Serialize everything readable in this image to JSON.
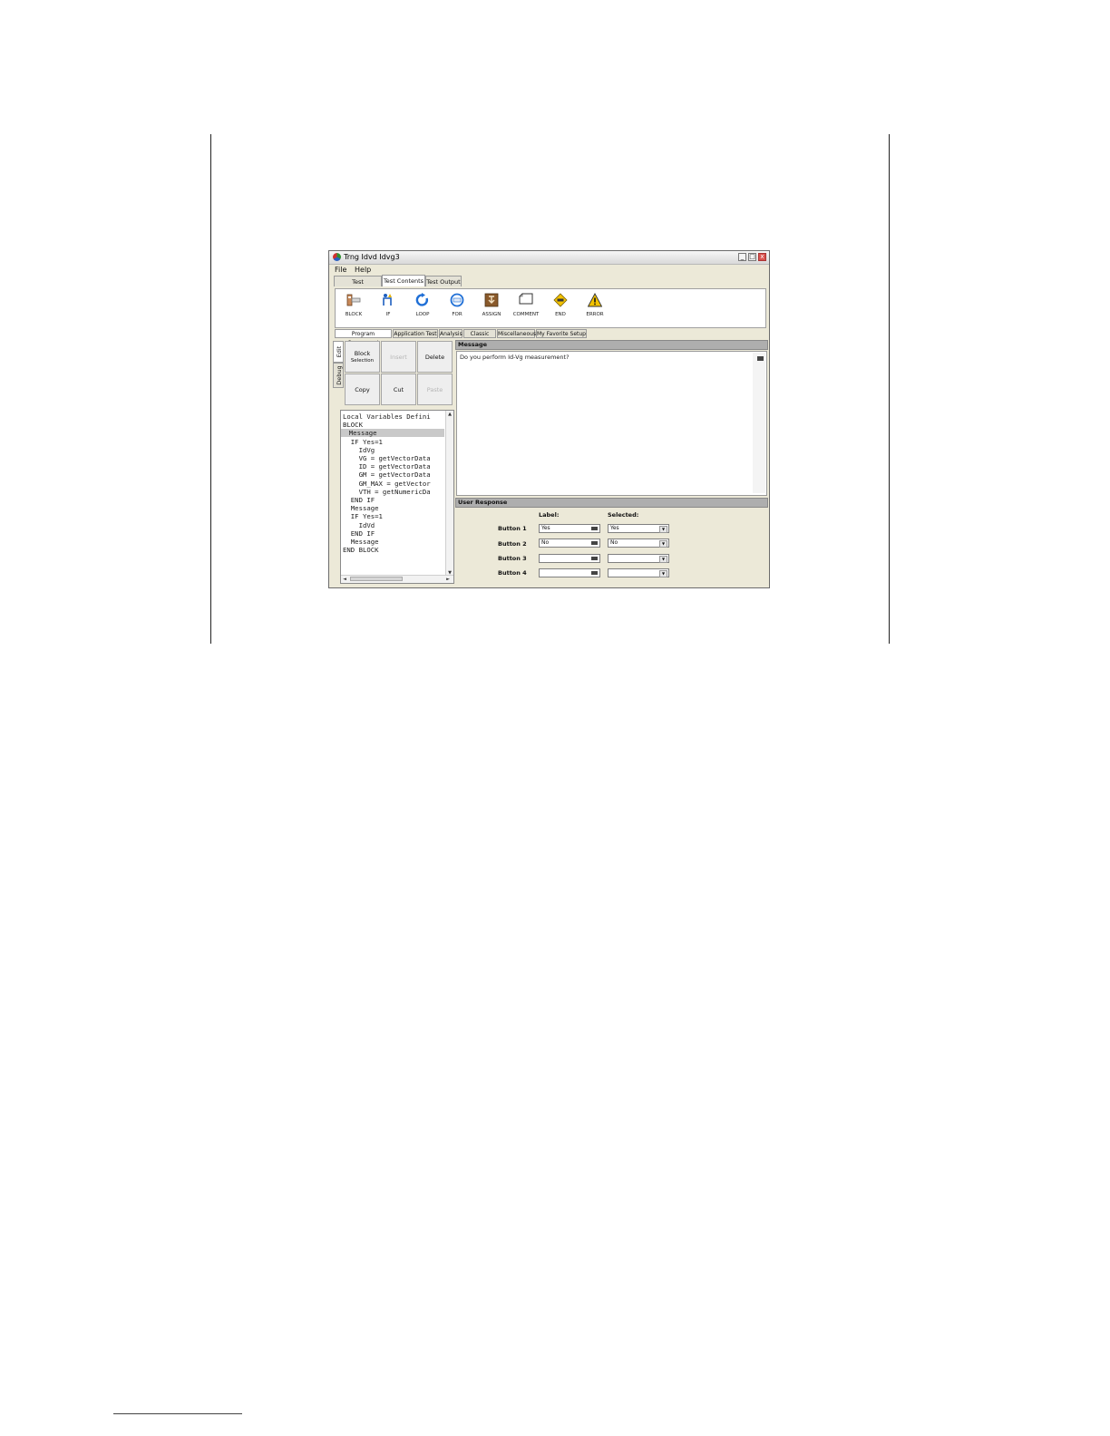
{
  "window": {
    "title": "Trng Idvd Idvg3",
    "controls": [
      "_",
      "□",
      "x"
    ]
  },
  "menu": [
    "File",
    "Help"
  ],
  "main_tabs": [
    "Test Specification",
    "Test Contents",
    "Test Output"
  ],
  "main_tab_active": "Test Contents",
  "palette": [
    {
      "label": "BLOCK",
      "icon": "block-icon"
    },
    {
      "label": "IF",
      "icon": "if-icon"
    },
    {
      "label": "LOOP",
      "icon": "loop-icon"
    },
    {
      "label": "FOR",
      "icon": "for-icon"
    },
    {
      "label": "ASSIGN",
      "icon": "assign-icon"
    },
    {
      "label": "COMMENT",
      "icon": "comment-icon"
    },
    {
      "label": "END",
      "icon": "end-icon"
    },
    {
      "label": "ERROR",
      "icon": "error-icon"
    }
  ],
  "component_tabs": [
    "Program Component",
    "Application Test",
    "Analysis",
    "Classic Test",
    "Miscellaneous",
    "My Favorite Setup"
  ],
  "component_tab_active": "Program Component",
  "side_tabs": [
    "Edit",
    "Debug"
  ],
  "edit_buttons": {
    "block": "Block",
    "block_sub": "Selection",
    "insert": "Insert",
    "delete": "Delete",
    "copy": "Copy",
    "cut": "Cut",
    "paste": "Paste"
  },
  "tree": [
    "Local Variables Defini",
    "BLOCK",
    "  Message",
    "  IF Yes=1",
    "    IdVg",
    "    VG = getVectorData",
    "    ID = getVectorData",
    "    GM = getVectorData",
    "    GM_MAX = getVector",
    "    VTH = getNumericDa",
    "  END IF",
    "  Message",
    "  IF Yes=1",
    "    IdVd",
    "  END IF",
    "  Message",
    "END BLOCK"
  ],
  "tree_selected_index": 2,
  "message": {
    "header": "Message",
    "text": "Do you perform Id-Vg measurement?"
  },
  "user_response": {
    "header": "User Response",
    "label_col": "Label:",
    "selected_col": "Selected:",
    "rows": [
      {
        "name": "Button 1",
        "label": "Yes",
        "selected": "Yes"
      },
      {
        "name": "Button 2",
        "label": "No",
        "selected": "No"
      },
      {
        "name": "Button 3",
        "label": "",
        "selected": ""
      },
      {
        "name": "Button 4",
        "label": "",
        "selected": ""
      }
    ]
  },
  "colors": {
    "window_bg": "#ece9d8",
    "header_bar": "#aeaeae",
    "selection": "#c9c9c9",
    "error_icon": "#f2c200",
    "loop_icon": "#1f6fd6"
  }
}
